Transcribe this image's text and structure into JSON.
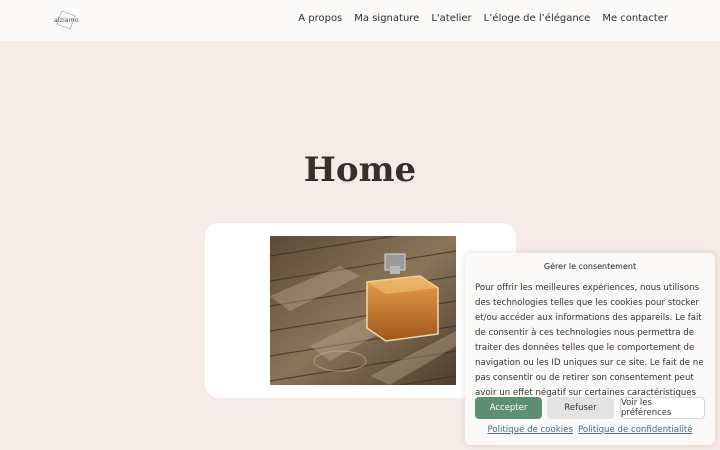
{
  "header": {
    "logo_text": "alziamo",
    "nav": [
      {
        "label": "A propos"
      },
      {
        "label": "Ma signature"
      },
      {
        "label": "L'atelier"
      },
      {
        "label": "L’éloge de l’élégance"
      },
      {
        "label": "Me contacter"
      }
    ]
  },
  "main": {
    "title": "Home",
    "image_alt": "perfume bottle on wooden table"
  },
  "cookie_banner": {
    "title": "Gérer le consentement",
    "text": "Pour offrir les meilleures expériences, nous utilisons des technologies telles que les cookies pour stocker et/ou accéder aux informations des appareils. Le fait de consentir à ces technologies nous permettra de traiter des données telles que le comportement de navigation ou les ID uniques sur ce site. Le fait de ne pas consentir ou de retirer son consentement peut avoir un effet négatif sur certaines caractéristiques et fonctions.",
    "accept_label": "Accepter",
    "refuse_label": "Refuser",
    "prefs_label": "Voir les préférences",
    "cookie_policy_label": "Politique de cookies",
    "privacy_policy_label": "Politique de confidentialité"
  }
}
